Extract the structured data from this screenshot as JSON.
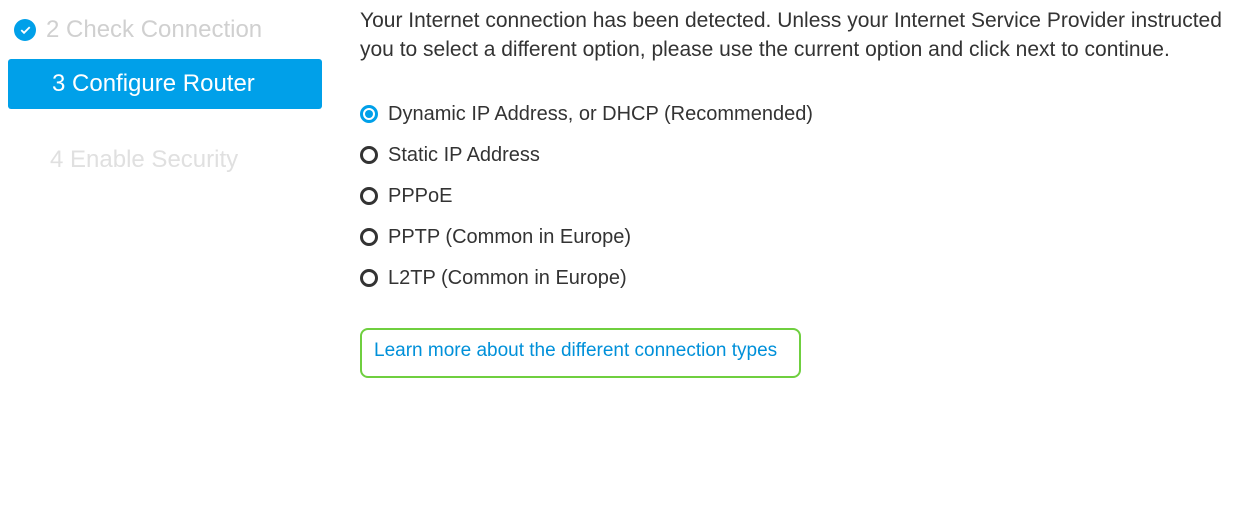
{
  "sidebar": {
    "steps": [
      {
        "number": "2",
        "label": "Check Connection"
      },
      {
        "number": "3",
        "label": "Configure Router"
      },
      {
        "number": "4",
        "label": "Enable Security"
      }
    ]
  },
  "main": {
    "instruction": "Your Internet connection has been detected. Unless your Internet Service Provider instructed you to select a different option, please use the current option and click next to continue.",
    "options": [
      "Dynamic IP Address, or DHCP (Recommended)",
      "Static IP Address",
      "PPPoE",
      "PPTP (Common in Europe)",
      "L2TP (Common in Europe)"
    ],
    "selected_index": 0,
    "learn_more": "Learn more about the different connection types"
  }
}
